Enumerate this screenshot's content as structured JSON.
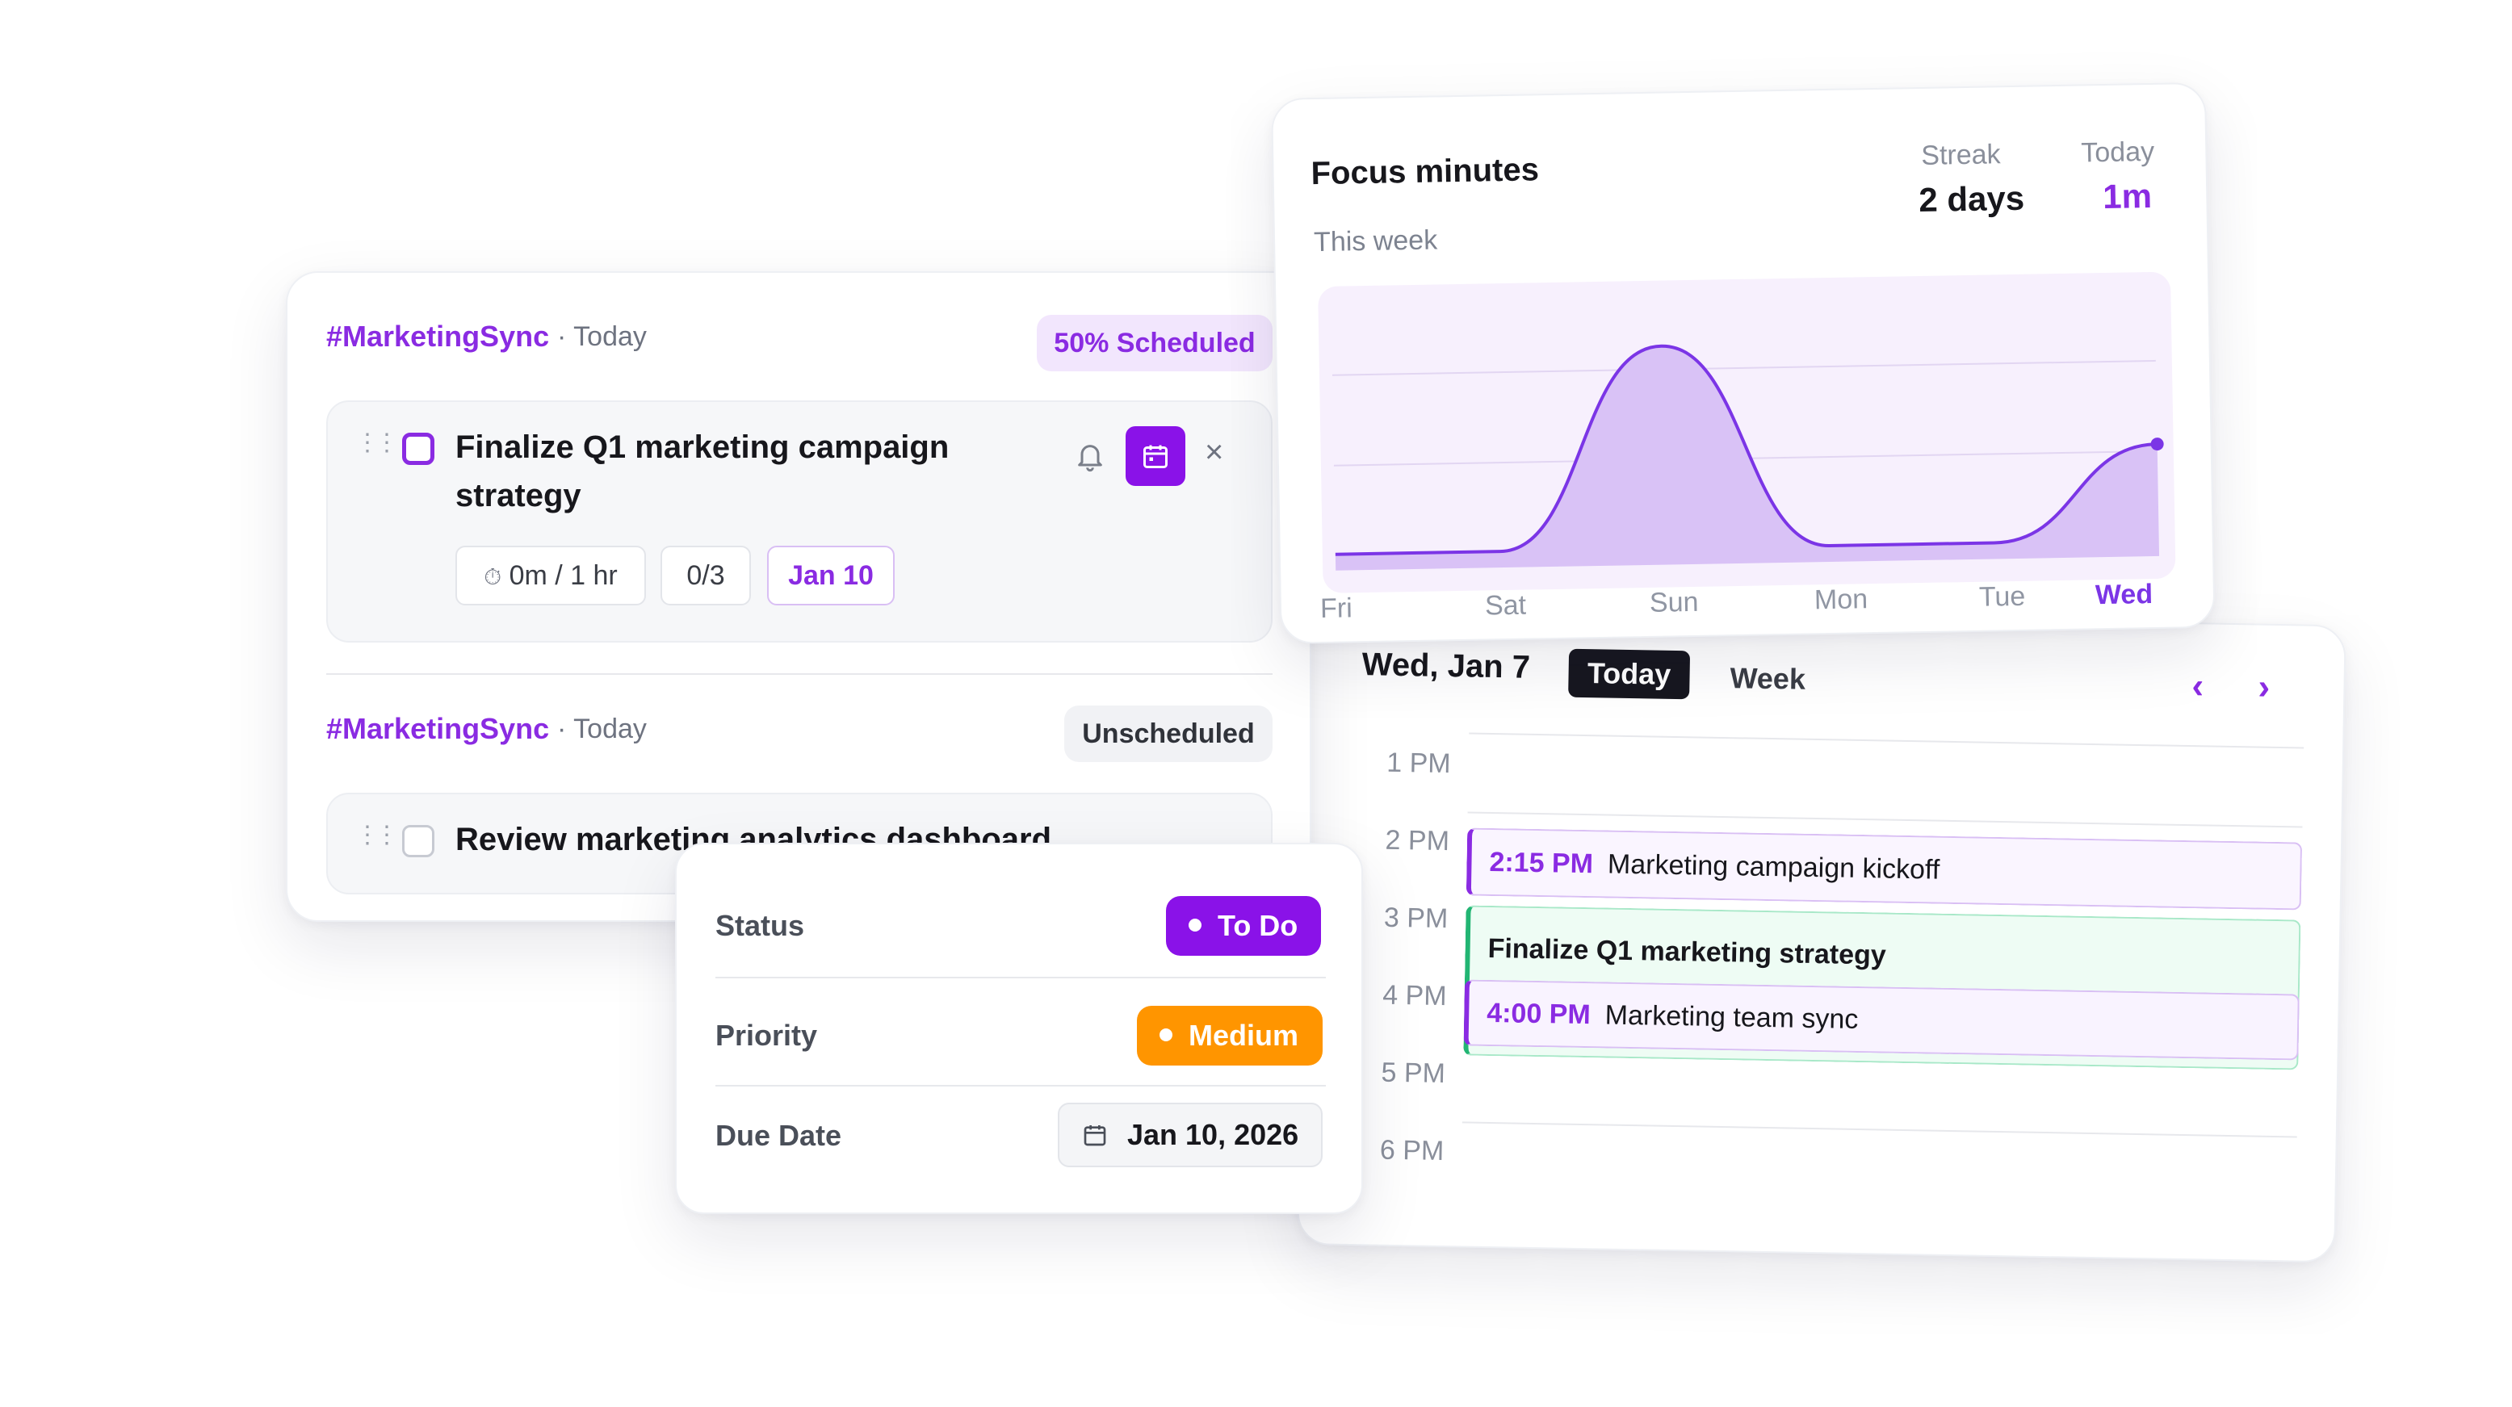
{
  "focus": {
    "title": "Focus minutes",
    "subtitle": "This week",
    "streak_label": "Streak",
    "streak_value": "2 days",
    "today_label": "Today",
    "today_value": "1m",
    "chart_data": {
      "type": "area",
      "categories": [
        "Fri",
        "Sat",
        "Sun",
        "Mon",
        "Tue",
        "Wed"
      ],
      "values": [
        0,
        0,
        95,
        0,
        0,
        45
      ],
      "grid": true,
      "accent": "#7b35e6",
      "fill": "#d9c2f6"
    }
  },
  "calendar": {
    "date": "Wed, Jan 7",
    "today_button": "Today",
    "week_button": "Week",
    "prev_icon": "chevron-left-icon",
    "next_icon": "chevron-right-icon",
    "hours": [
      "1 PM",
      "2 PM",
      "3 PM",
      "4 PM",
      "5 PM",
      "6 PM"
    ],
    "events": [
      {
        "time": "2:15 PM",
        "title": "Marketing campaign kickoff",
        "color": "#8a2be2"
      },
      {
        "time": "",
        "title": "Finalize Q1 marketing strategy",
        "color": "#22b573"
      },
      {
        "time": "4:00 PM",
        "title": "Marketing team sync",
        "color": "#8a2be2"
      }
    ]
  },
  "tasks": {
    "groups": [
      {
        "tag": "#MarketingSync",
        "when": "· Today",
        "badge": "50% Scheduled",
        "task": {
          "title_line1": "Finalize Q1 marketing campaign",
          "title_line2": "strategy",
          "timer": "0m / 1 hr",
          "subtasks": "0/3",
          "due": "Jan 10",
          "icons": [
            "bell-icon",
            "calendar-icon",
            "close-icon"
          ]
        }
      },
      {
        "tag": "#MarketingSync",
        "when": "· Today",
        "badge": "Unscheduled",
        "task": {
          "title": "Review marketing analytics dashboard"
        }
      }
    ]
  },
  "details": {
    "status_label": "Status",
    "status_value": "To Do",
    "status_color": "#8a12e8",
    "priority_label": "Priority",
    "priority_value": "Medium",
    "priority_color": "#ff9500",
    "due_label": "Due Date",
    "due_value": "Jan 10, 2026"
  }
}
